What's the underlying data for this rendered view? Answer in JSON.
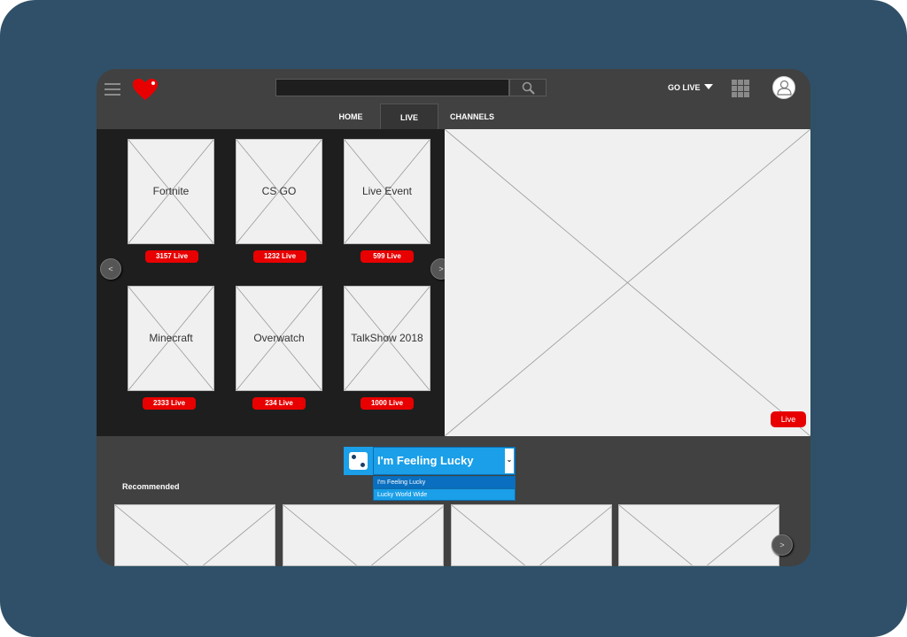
{
  "header": {
    "menu_icon": "hamburger-icon",
    "logo": "heart-logo",
    "search": {
      "placeholder": "",
      "value": ""
    },
    "search_icon": "search-icon",
    "go_live_label": "GO LIVE",
    "apps_icon": "grid-icon",
    "avatar_icon": "user-icon"
  },
  "tabs": [
    {
      "label": "HOME"
    },
    {
      "label": "LIVE",
      "active": true
    },
    {
      "label": "CHANNELS"
    }
  ],
  "games": [
    {
      "name": "Fortnite",
      "live": "3157 Live"
    },
    {
      "name": "CS GO",
      "live": "1232 Live"
    },
    {
      "name": "Live Event",
      "live": "599 Live"
    },
    {
      "name": "Minecraft",
      "live": "2333 Live"
    },
    {
      "name": "Overwatch",
      "live": "234 Live"
    },
    {
      "name": "TalkShow 2018",
      "live": "1000 Live"
    }
  ],
  "carousel": {
    "prev_label": "<",
    "next_label": ">"
  },
  "video": {
    "live_badge": "Live"
  },
  "lucky": {
    "selected": "I'm Feeling Lucky",
    "options": [
      "I'm Feeling Lucky",
      "Lucky World Wide"
    ]
  },
  "recommended": {
    "title": "Recommended",
    "next_label": ">"
  },
  "colors": {
    "background": "#2f5068",
    "app": "#414141",
    "accent": "#e80000",
    "lucky_blue": "#1a9fe8"
  }
}
